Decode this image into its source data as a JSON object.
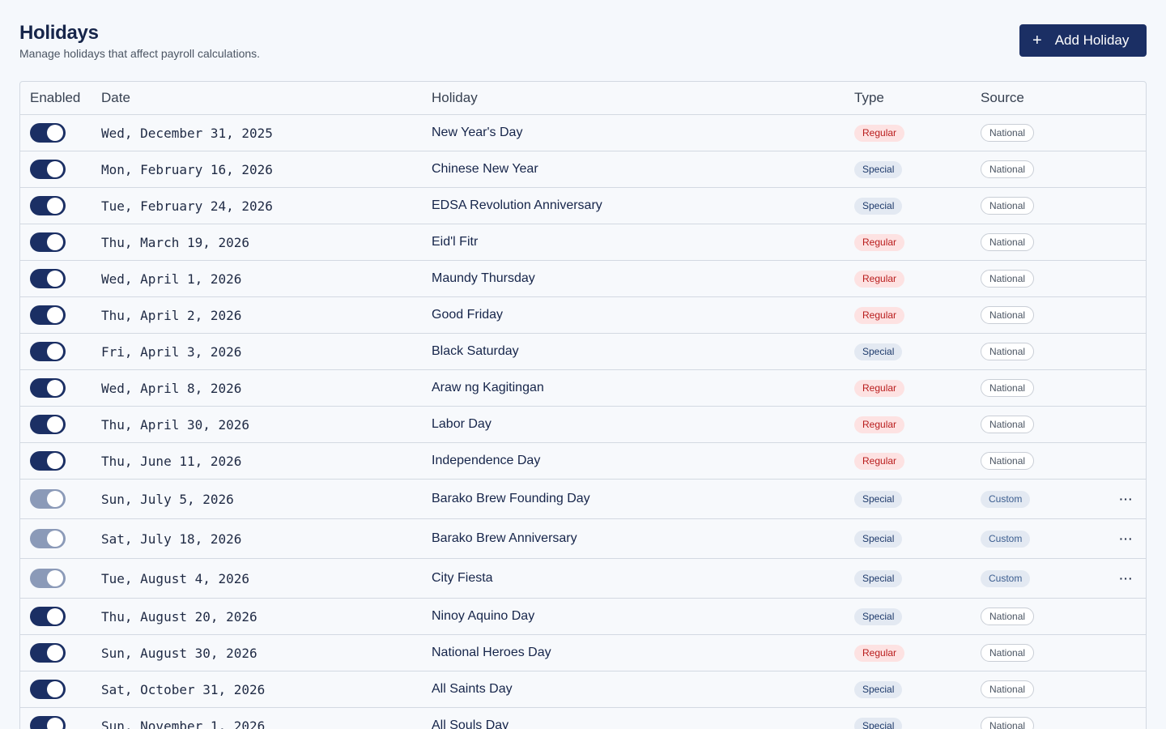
{
  "header": {
    "title": "Holidays",
    "subtitle": "Manage holidays that affect payroll calculations.",
    "add_button_label": "Add Holiday",
    "add_button_icon": "+"
  },
  "table": {
    "columns": {
      "enabled": "Enabled",
      "date": "Date",
      "holiday": "Holiday",
      "type": "Type",
      "source": "Source"
    },
    "rows": [
      {
        "enabled": true,
        "date": "Wed, December 31, 2025",
        "holiday": "New Year's Day",
        "type": "Regular",
        "source": "National"
      },
      {
        "enabled": true,
        "date": "Mon, February 16, 2026",
        "holiday": "Chinese New Year",
        "type": "Special",
        "source": "National"
      },
      {
        "enabled": true,
        "date": "Tue, February 24, 2026",
        "holiday": "EDSA Revolution Anniversary",
        "type": "Special",
        "source": "National"
      },
      {
        "enabled": true,
        "date": "Thu, March 19, 2026",
        "holiday": "Eid'l Fitr",
        "type": "Regular",
        "source": "National"
      },
      {
        "enabled": true,
        "date": "Wed, April 1, 2026",
        "holiday": "Maundy Thursday",
        "type": "Regular",
        "source": "National"
      },
      {
        "enabled": true,
        "date": "Thu, April 2, 2026",
        "holiday": "Good Friday",
        "type": "Regular",
        "source": "National"
      },
      {
        "enabled": true,
        "date": "Fri, April 3, 2026",
        "holiday": "Black Saturday",
        "type": "Special",
        "source": "National"
      },
      {
        "enabled": true,
        "date": "Wed, April 8, 2026",
        "holiday": "Araw ng Kagitingan",
        "type": "Regular",
        "source": "National"
      },
      {
        "enabled": true,
        "date": "Thu, April 30, 2026",
        "holiday": "Labor Day",
        "type": "Regular",
        "source": "National"
      },
      {
        "enabled": true,
        "date": "Thu, June 11, 2026",
        "holiday": "Independence Day",
        "type": "Regular",
        "source": "National"
      },
      {
        "enabled": false,
        "date": "Sun, July 5, 2026",
        "holiday": "Barako Brew Founding Day",
        "type": "Special",
        "source": "Custom",
        "actions": "···"
      },
      {
        "enabled": false,
        "date": "Sat, July 18, 2026",
        "holiday": "Barako Brew Anniversary",
        "type": "Special",
        "source": "Custom",
        "actions": "···"
      },
      {
        "enabled": false,
        "date": "Tue, August 4, 2026",
        "holiday": "City Fiesta",
        "type": "Special",
        "source": "Custom",
        "actions": "···"
      },
      {
        "enabled": true,
        "date": "Thu, August 20, 2026",
        "holiday": "Ninoy Aquino Day",
        "type": "Special",
        "source": "National"
      },
      {
        "enabled": true,
        "date": "Sun, August 30, 2026",
        "holiday": "National Heroes Day",
        "type": "Regular",
        "source": "National"
      },
      {
        "enabled": true,
        "date": "Sat, October 31, 2026",
        "holiday": "All Saints Day",
        "type": "Special",
        "source": "National"
      },
      {
        "enabled": true,
        "date": "Sun, November 1, 2026",
        "holiday": "All Souls Day",
        "type": "Special",
        "source": "National"
      }
    ]
  },
  "colors": {
    "primary": "#1b2f64",
    "toggle_off": "#8b9ab8",
    "regular_bg": "#fde2e2",
    "regular_text": "#b91c1c",
    "special_bg": "#e3e9f2",
    "special_text": "#1e3a6b"
  }
}
